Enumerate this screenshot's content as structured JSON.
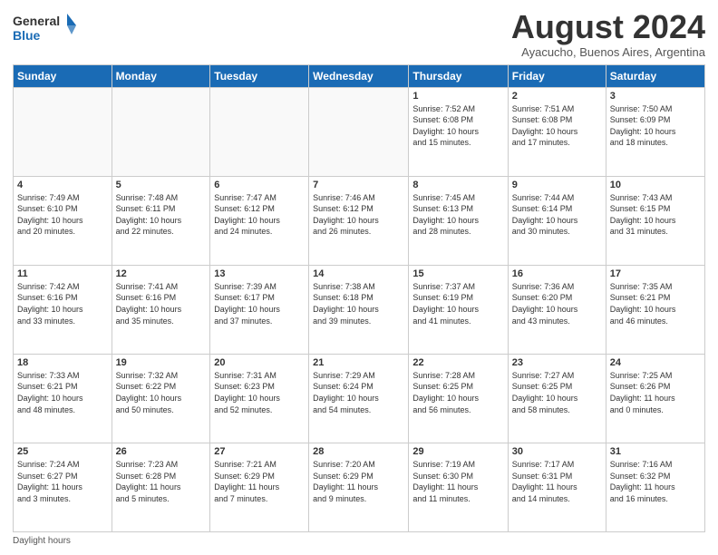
{
  "header": {
    "logo_line1": "General",
    "logo_line2": "Blue",
    "main_title": "August 2024",
    "subtitle": "Ayacucho, Buenos Aires, Argentina"
  },
  "days_of_week": [
    "Sunday",
    "Monday",
    "Tuesday",
    "Wednesday",
    "Thursday",
    "Friday",
    "Saturday"
  ],
  "footer": {
    "label": "Daylight hours"
  },
  "weeks": [
    [
      {
        "day": "",
        "info": ""
      },
      {
        "day": "",
        "info": ""
      },
      {
        "day": "",
        "info": ""
      },
      {
        "day": "",
        "info": ""
      },
      {
        "day": "1",
        "info": "Sunrise: 7:52 AM\nSunset: 6:08 PM\nDaylight: 10 hours\nand 15 minutes."
      },
      {
        "day": "2",
        "info": "Sunrise: 7:51 AM\nSunset: 6:08 PM\nDaylight: 10 hours\nand 17 minutes."
      },
      {
        "day": "3",
        "info": "Sunrise: 7:50 AM\nSunset: 6:09 PM\nDaylight: 10 hours\nand 18 minutes."
      }
    ],
    [
      {
        "day": "4",
        "info": "Sunrise: 7:49 AM\nSunset: 6:10 PM\nDaylight: 10 hours\nand 20 minutes."
      },
      {
        "day": "5",
        "info": "Sunrise: 7:48 AM\nSunset: 6:11 PM\nDaylight: 10 hours\nand 22 minutes."
      },
      {
        "day": "6",
        "info": "Sunrise: 7:47 AM\nSunset: 6:12 PM\nDaylight: 10 hours\nand 24 minutes."
      },
      {
        "day": "7",
        "info": "Sunrise: 7:46 AM\nSunset: 6:12 PM\nDaylight: 10 hours\nand 26 minutes."
      },
      {
        "day": "8",
        "info": "Sunrise: 7:45 AM\nSunset: 6:13 PM\nDaylight: 10 hours\nand 28 minutes."
      },
      {
        "day": "9",
        "info": "Sunrise: 7:44 AM\nSunset: 6:14 PM\nDaylight: 10 hours\nand 30 minutes."
      },
      {
        "day": "10",
        "info": "Sunrise: 7:43 AM\nSunset: 6:15 PM\nDaylight: 10 hours\nand 31 minutes."
      }
    ],
    [
      {
        "day": "11",
        "info": "Sunrise: 7:42 AM\nSunset: 6:16 PM\nDaylight: 10 hours\nand 33 minutes."
      },
      {
        "day": "12",
        "info": "Sunrise: 7:41 AM\nSunset: 6:16 PM\nDaylight: 10 hours\nand 35 minutes."
      },
      {
        "day": "13",
        "info": "Sunrise: 7:39 AM\nSunset: 6:17 PM\nDaylight: 10 hours\nand 37 minutes."
      },
      {
        "day": "14",
        "info": "Sunrise: 7:38 AM\nSunset: 6:18 PM\nDaylight: 10 hours\nand 39 minutes."
      },
      {
        "day": "15",
        "info": "Sunrise: 7:37 AM\nSunset: 6:19 PM\nDaylight: 10 hours\nand 41 minutes."
      },
      {
        "day": "16",
        "info": "Sunrise: 7:36 AM\nSunset: 6:20 PM\nDaylight: 10 hours\nand 43 minutes."
      },
      {
        "day": "17",
        "info": "Sunrise: 7:35 AM\nSunset: 6:21 PM\nDaylight: 10 hours\nand 46 minutes."
      }
    ],
    [
      {
        "day": "18",
        "info": "Sunrise: 7:33 AM\nSunset: 6:21 PM\nDaylight: 10 hours\nand 48 minutes."
      },
      {
        "day": "19",
        "info": "Sunrise: 7:32 AM\nSunset: 6:22 PM\nDaylight: 10 hours\nand 50 minutes."
      },
      {
        "day": "20",
        "info": "Sunrise: 7:31 AM\nSunset: 6:23 PM\nDaylight: 10 hours\nand 52 minutes."
      },
      {
        "day": "21",
        "info": "Sunrise: 7:29 AM\nSunset: 6:24 PM\nDaylight: 10 hours\nand 54 minutes."
      },
      {
        "day": "22",
        "info": "Sunrise: 7:28 AM\nSunset: 6:25 PM\nDaylight: 10 hours\nand 56 minutes."
      },
      {
        "day": "23",
        "info": "Sunrise: 7:27 AM\nSunset: 6:25 PM\nDaylight: 10 hours\nand 58 minutes."
      },
      {
        "day": "24",
        "info": "Sunrise: 7:25 AM\nSunset: 6:26 PM\nDaylight: 11 hours\nand 0 minutes."
      }
    ],
    [
      {
        "day": "25",
        "info": "Sunrise: 7:24 AM\nSunset: 6:27 PM\nDaylight: 11 hours\nand 3 minutes."
      },
      {
        "day": "26",
        "info": "Sunrise: 7:23 AM\nSunset: 6:28 PM\nDaylight: 11 hours\nand 5 minutes."
      },
      {
        "day": "27",
        "info": "Sunrise: 7:21 AM\nSunset: 6:29 PM\nDaylight: 11 hours\nand 7 minutes."
      },
      {
        "day": "28",
        "info": "Sunrise: 7:20 AM\nSunset: 6:29 PM\nDaylight: 11 hours\nand 9 minutes."
      },
      {
        "day": "29",
        "info": "Sunrise: 7:19 AM\nSunset: 6:30 PM\nDaylight: 11 hours\nand 11 minutes."
      },
      {
        "day": "30",
        "info": "Sunrise: 7:17 AM\nSunset: 6:31 PM\nDaylight: 11 hours\nand 14 minutes."
      },
      {
        "day": "31",
        "info": "Sunrise: 7:16 AM\nSunset: 6:32 PM\nDaylight: 11 hours\nand 16 minutes."
      }
    ]
  ]
}
